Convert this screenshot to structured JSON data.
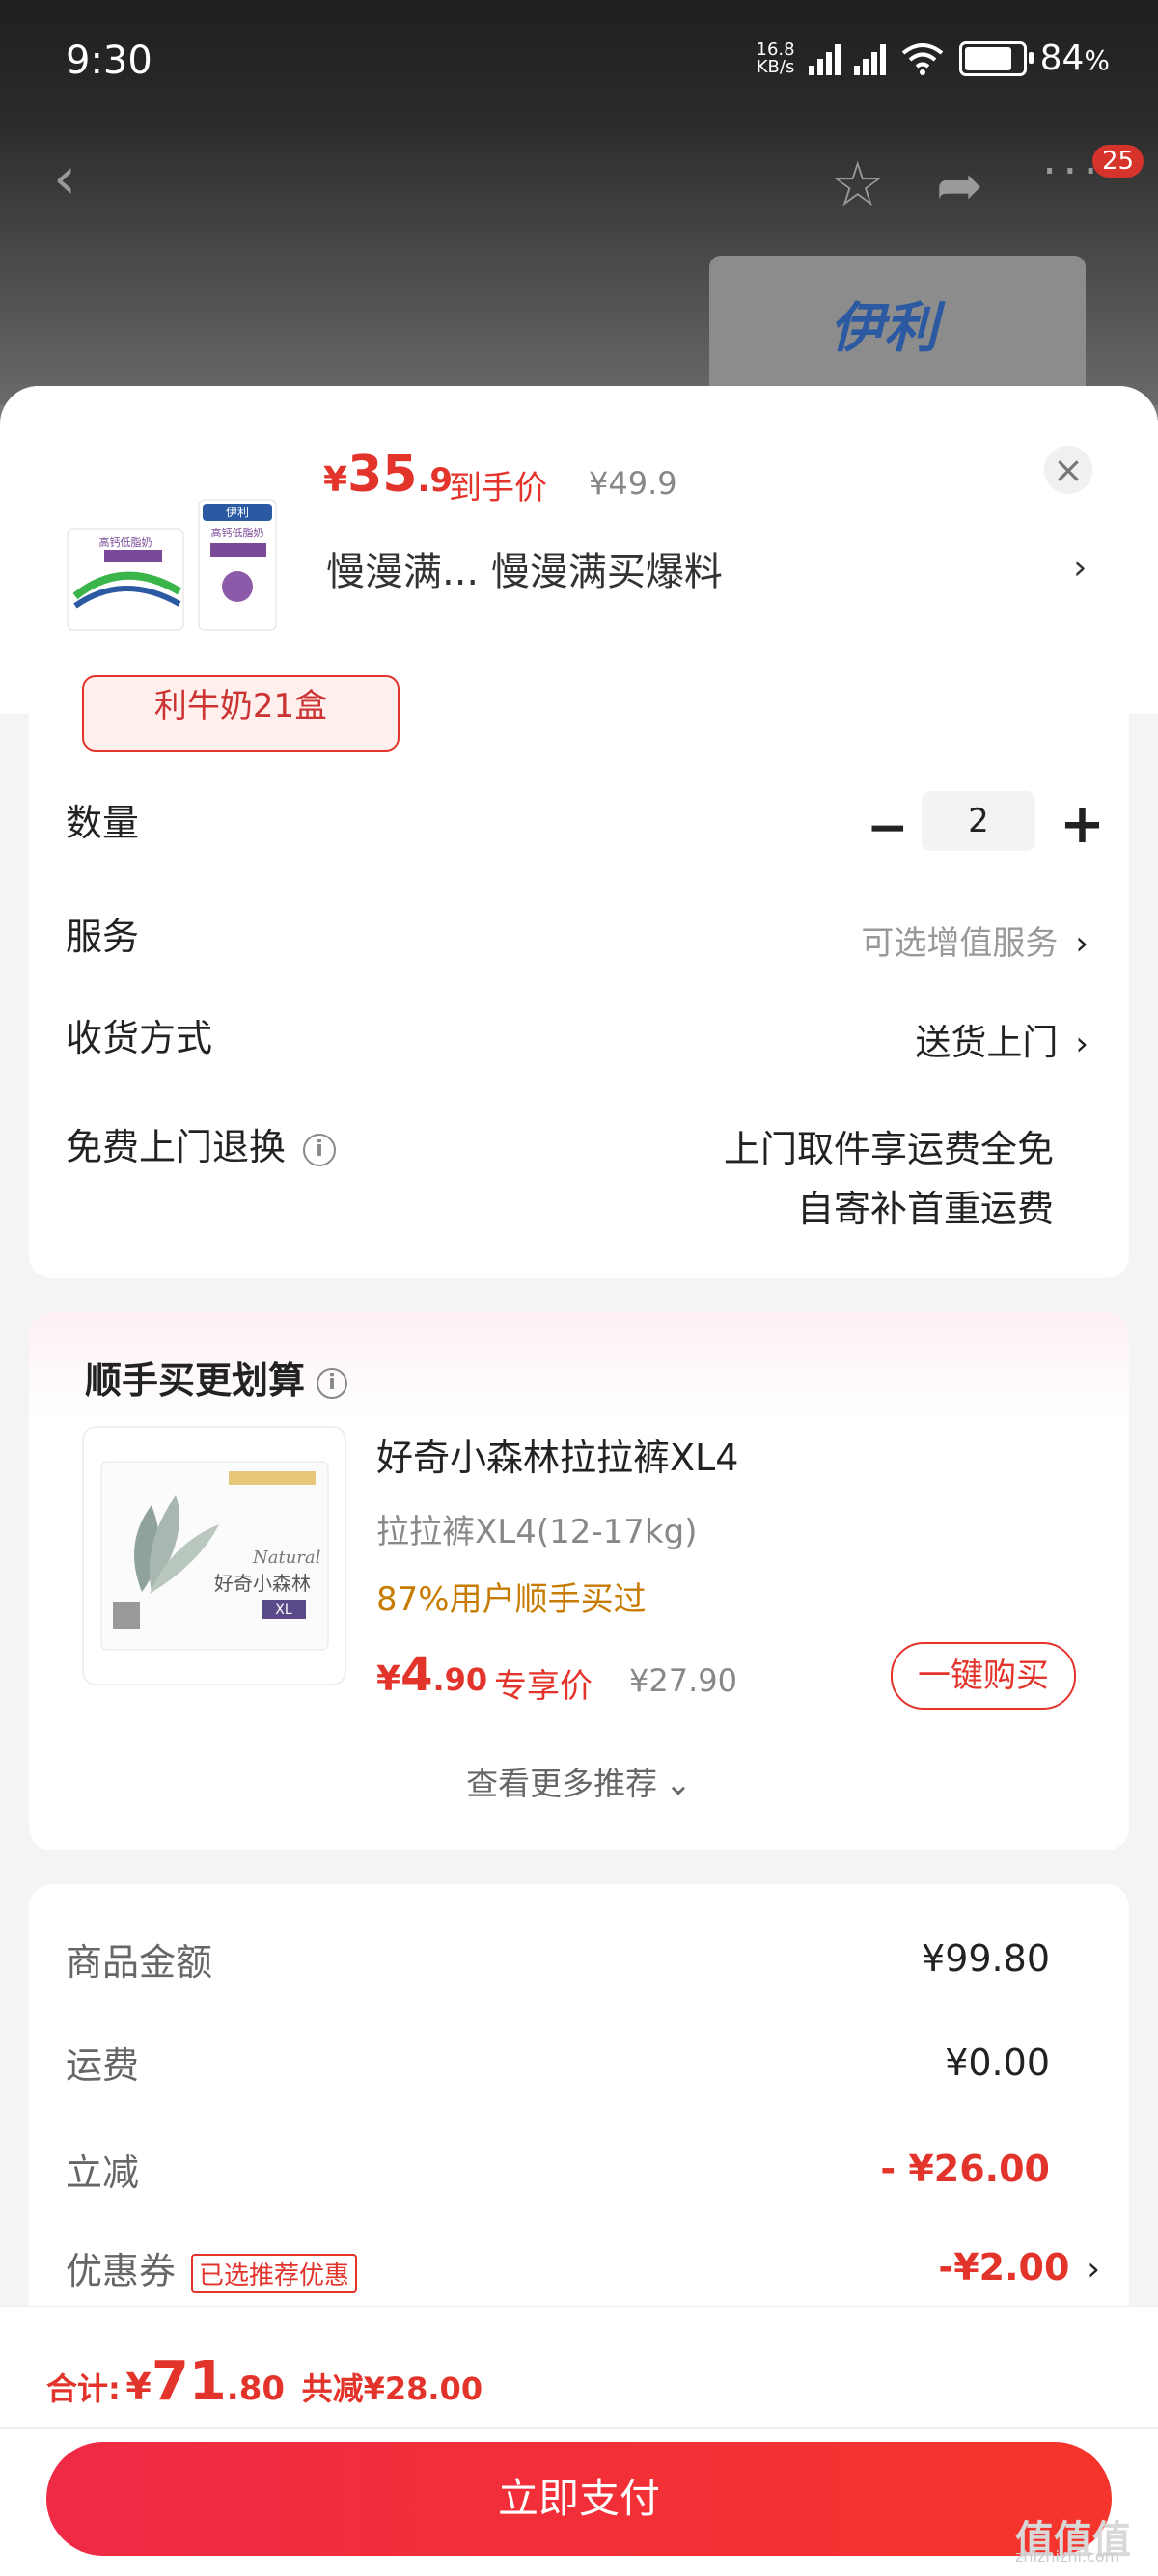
{
  "status": {
    "time": "9:30",
    "net_speed_top": "16.8",
    "net_speed_bottom": "KB/s",
    "battery": "84",
    "battery_pct": 84,
    "battery_unit": "%"
  },
  "nav": {
    "badge_count": "25",
    "brand_logo": "伊利"
  },
  "header": {
    "price_currency": "¥",
    "price_int": "35",
    "price_dec": ".9",
    "price_label": "到手价",
    "original_price": "¥49.9",
    "title": "慢漫满...  慢漫满买爆料",
    "thumb_brand": "伊利",
    "thumb_product": "高钙低脂奶"
  },
  "spec_chip": "利牛奶21盒",
  "options": {
    "quantity_label": "数量",
    "quantity_value": "2",
    "service_label": "服务",
    "service_value": "可选增值服务",
    "delivery_label": "收货方式",
    "delivery_value": "送货上门",
    "return_label": "免费上门退换",
    "return_value_line1": "上门取件享运费全免",
    "return_value_line2": "自寄补首重运费"
  },
  "recommend": {
    "title": "顺手买更划算",
    "product_name": "好奇小森林拉拉裤XL4",
    "spec": "拉拉裤XL4(12-17kg)",
    "buyers_pct": "87%用户顺手买过",
    "price_currency": "¥",
    "price_int": "4",
    "price_dec": ".90",
    "price_label": "专享价",
    "original_price": "¥27.90",
    "buy_button": "一键购买",
    "see_more": "查看更多推荐",
    "image_brand": "好奇小森林",
    "image_natural": "Natural",
    "image_size": "XL"
  },
  "summary": {
    "goods_label": "商品金额",
    "goods_value": "¥99.80",
    "shipping_label": "运费",
    "shipping_value": "¥0.00",
    "discount_label": "立减",
    "discount_value": "- ¥26.00",
    "coupon_label": "优惠券",
    "coupon_tag": "已选推荐优惠",
    "coupon_value": "-¥2.00"
  },
  "footer": {
    "total_label": "合计:",
    "total_currency": "¥",
    "total_int": "71",
    "total_dec": ".80",
    "saved": "共减¥28.00",
    "pay_button": "立即支付",
    "watermark": "值值值",
    "watermark_url": "zhizhizhi.com"
  },
  "colors": {
    "accent": "#e3342b",
    "orange": "#c77b00"
  }
}
